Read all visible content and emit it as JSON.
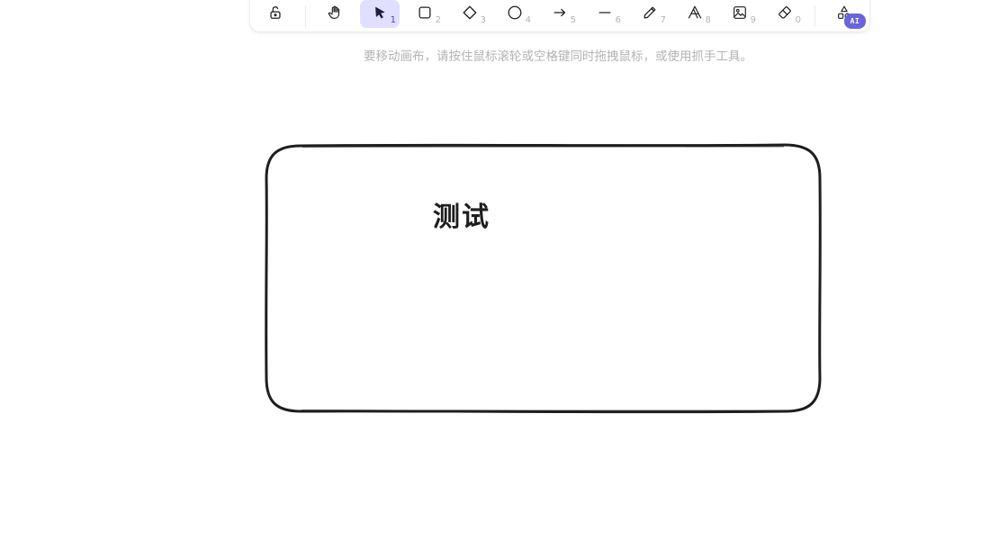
{
  "toolbar": {
    "tools": [
      {
        "name": "lock",
        "icon": "lock-open-icon",
        "key": ""
      },
      {
        "name": "hand",
        "icon": "hand-icon",
        "key": ""
      },
      {
        "name": "selection",
        "icon": "cursor-icon",
        "key": "1",
        "active": true
      },
      {
        "name": "rectangle",
        "icon": "square-icon",
        "key": "2"
      },
      {
        "name": "diamond",
        "icon": "diamond-icon",
        "key": "3"
      },
      {
        "name": "ellipse",
        "icon": "circle-icon",
        "key": "4"
      },
      {
        "name": "arrow",
        "icon": "arrow-right-icon",
        "key": "5"
      },
      {
        "name": "line",
        "icon": "line-icon",
        "key": "6"
      },
      {
        "name": "draw",
        "icon": "pencil-icon",
        "key": "7"
      },
      {
        "name": "text",
        "icon": "text-icon",
        "key": "8"
      },
      {
        "name": "image",
        "icon": "image-icon",
        "key": "9"
      },
      {
        "name": "eraser",
        "icon": "eraser-icon",
        "key": "0"
      },
      {
        "name": "more-tools",
        "icon": "shapes-icon",
        "key": ""
      }
    ],
    "ai_badge": "AI",
    "accent_color": "#6965db",
    "active_bg": "#e0dfff"
  },
  "hint": "要移动画布，请按住鼠标滚轮或空格键同时拖拽鼠标，或使用抓手工具。",
  "canvas": {
    "shape": {
      "type": "rounded-rectangle",
      "stroke_color": "#1e1e1e",
      "label": "测试"
    }
  }
}
